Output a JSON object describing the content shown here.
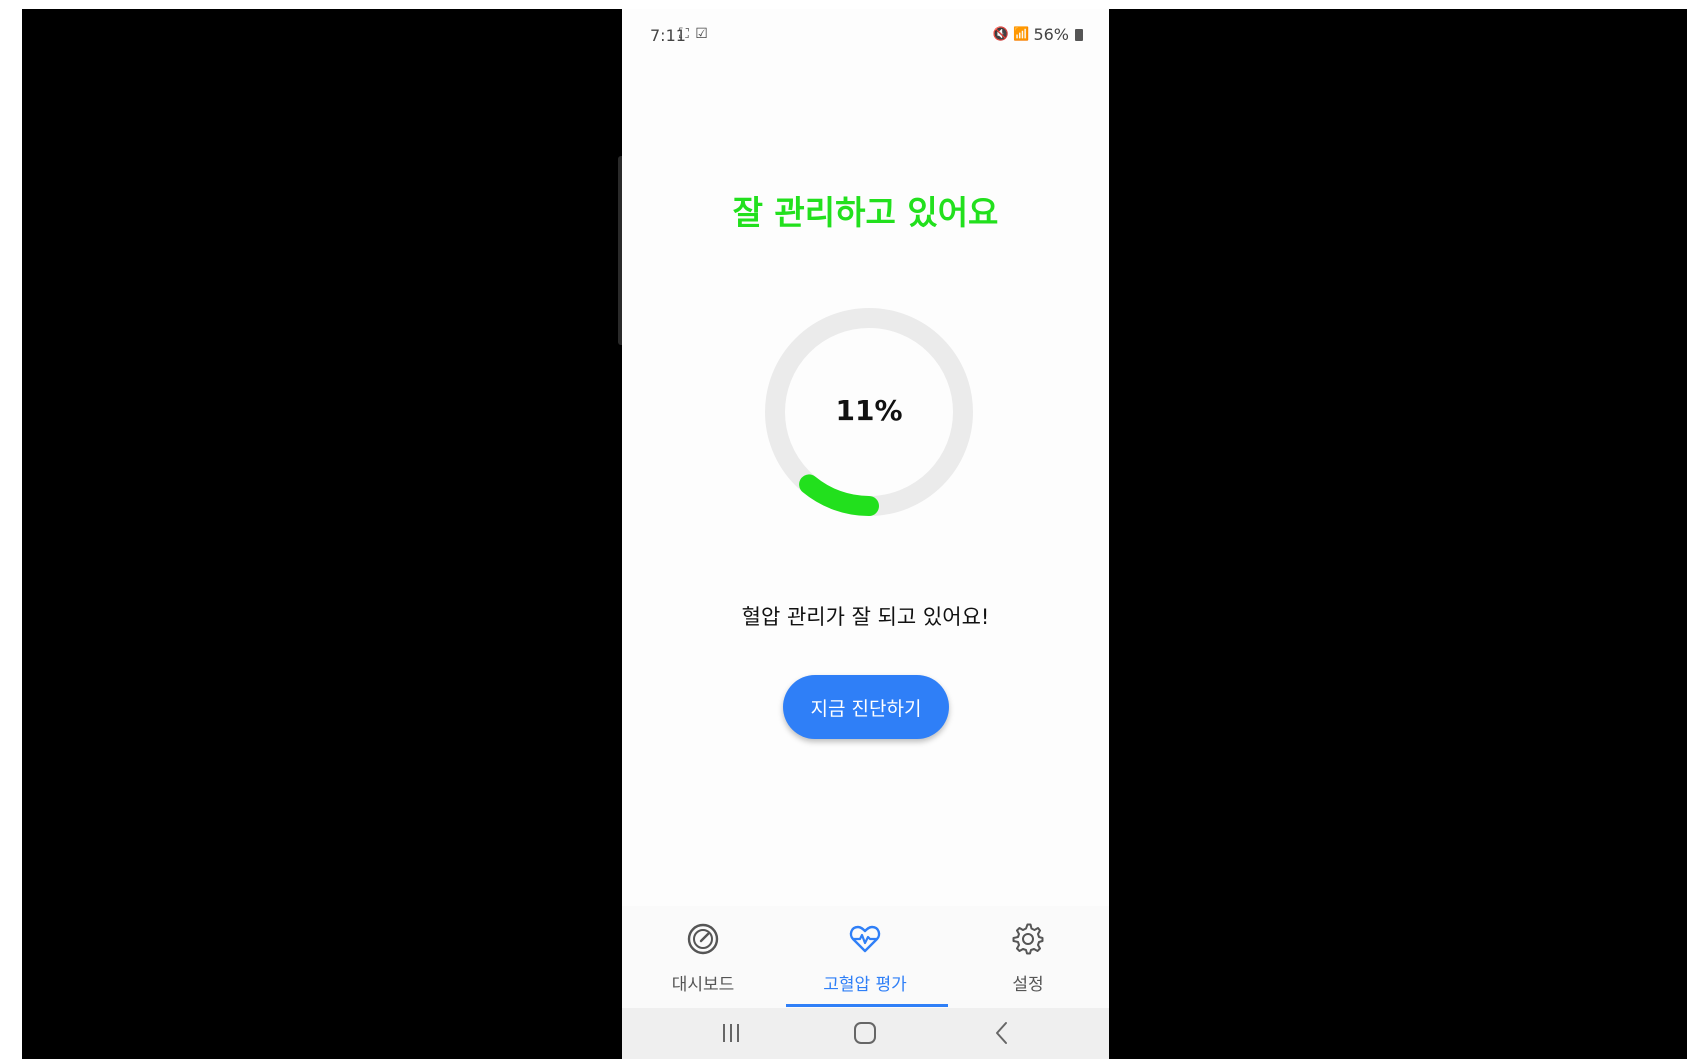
{
  "status_bar": {
    "time": "7:11",
    "left_icons": "⛶ ☑",
    "signal": "🔇 📶",
    "battery": "56%"
  },
  "main": {
    "headline": "잘 관리하고 있어요",
    "gauge": {
      "value_text": "11%",
      "value": 11,
      "color": "#22e01d",
      "track_color": "#ebebeb"
    },
    "message": "혈압 관리가 잘 되고 있어요!",
    "diagnose_button": "지금 진단하기"
  },
  "bottom_nav": {
    "items": [
      {
        "label": "대시보드",
        "icon": "gauge-icon"
      },
      {
        "label": "고혈압 평가",
        "icon": "heart-pulse-icon",
        "active": true
      },
      {
        "label": "설정",
        "icon": "gear-icon"
      }
    ]
  },
  "system_nav": {
    "recents": "recents-icon",
    "home": "home-icon",
    "back": "back-icon"
  },
  "colors": {
    "accent": "#2f7ff7",
    "success": "#22e01d"
  }
}
